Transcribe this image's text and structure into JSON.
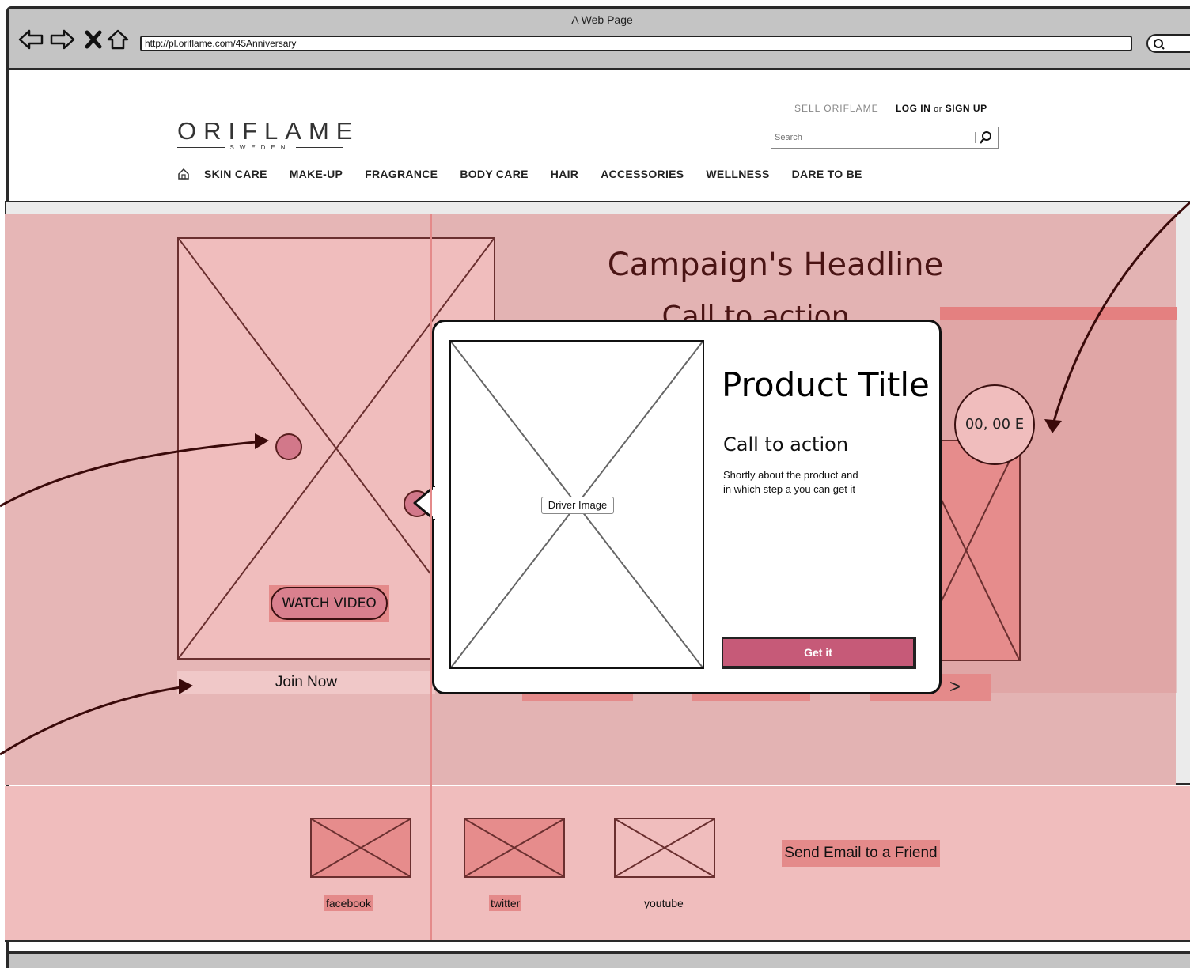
{
  "browser": {
    "window_title": "A Web Page",
    "url": "http://pl.oriflame.com/45Anniversary"
  },
  "header": {
    "logo_text": "ORIFLAME",
    "logo_subtext": "SWEDEN",
    "sell_link": "SELL ORIFLAME",
    "login_label": "LOG IN",
    "or_label": "or",
    "signup_label": "SIGN UP",
    "search_placeholder": "Search"
  },
  "nav": {
    "items": [
      "SKIN CARE",
      "MAKE-UP",
      "FRAGRANCE",
      "BODY CARE",
      "HAIR",
      "ACCESSORIES",
      "WELLNESS",
      "DARE TO BE"
    ]
  },
  "campaign": {
    "headline": "Campaign's Headline",
    "call_to_action": "Call to action",
    "watch_video": "WATCH VIDEO",
    "join_now": "Join Now",
    "next_arrow": ">",
    "price": "00, 00 E"
  },
  "popup": {
    "image_label": "Driver Image",
    "product_title": "Product Title",
    "call_to_action": "Call to action",
    "description_line1": "Shortly about the product and",
    "description_line2": "in which step a you can get it",
    "button_label": "Get it"
  },
  "footer": {
    "social": [
      "facebook",
      "twitter",
      "youtube"
    ],
    "send_email": "Send Email to a Friend"
  },
  "colors": {
    "campaign_bg": "#e3b3b3",
    "highlight": "#e48a8a",
    "button": "#c65a78"
  }
}
